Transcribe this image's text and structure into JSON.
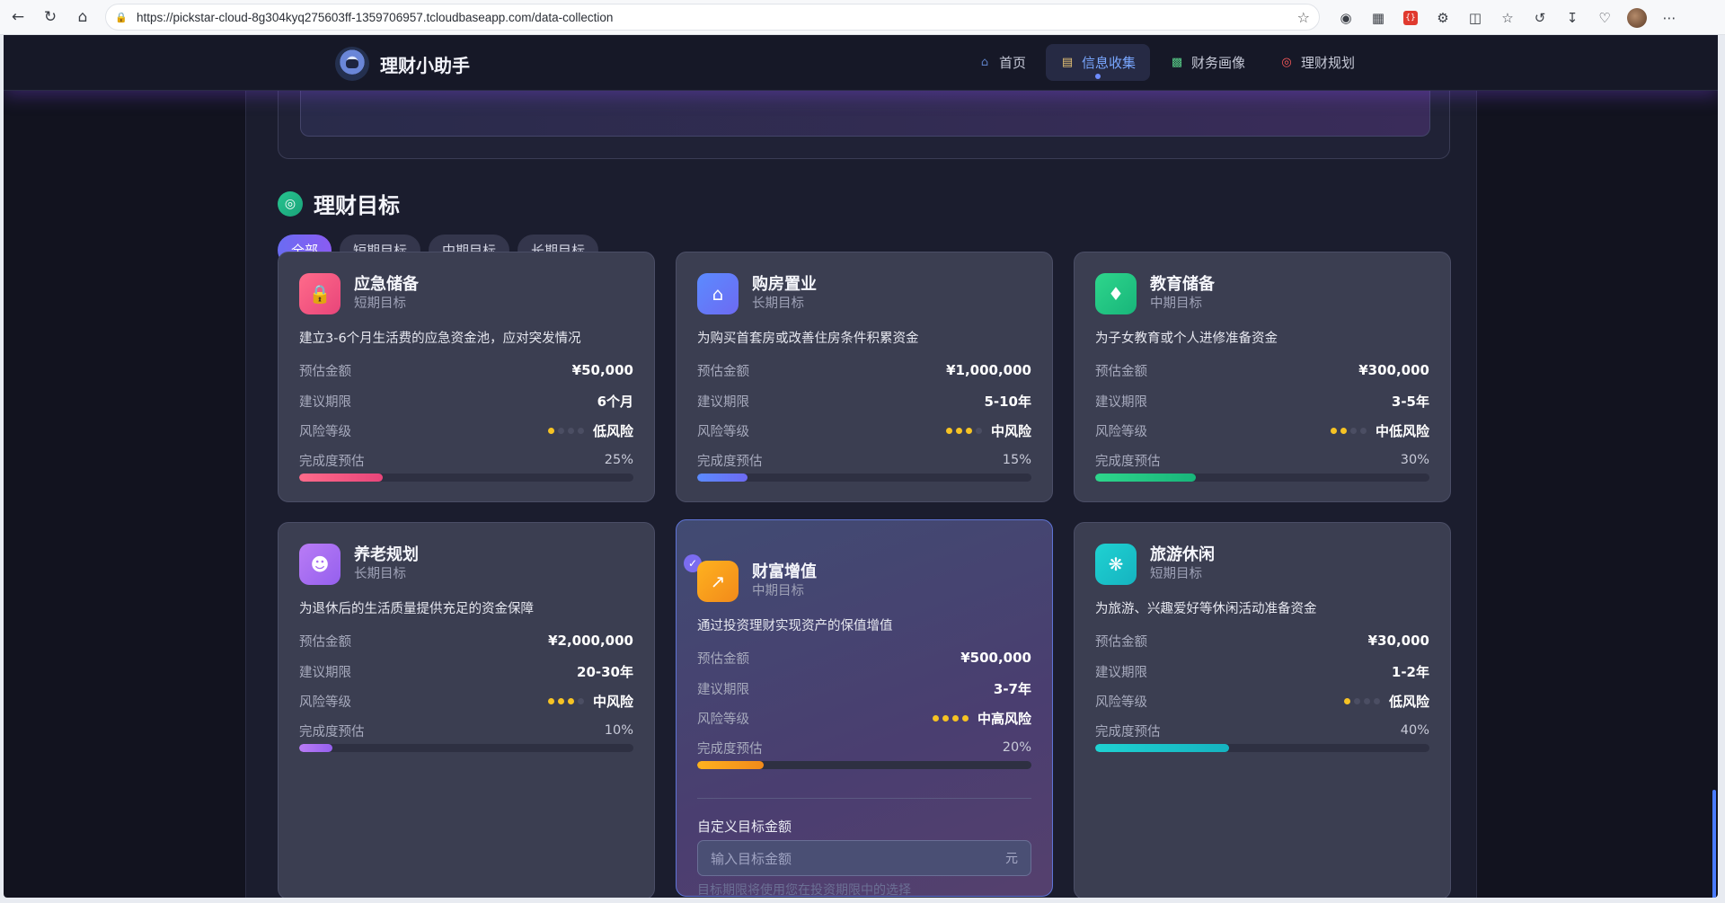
{
  "browser": {
    "url": "https://pickstar-cloud-8g304kyq275603ff-1359706957.tcloudbaseapp.com/data-collection"
  },
  "app": {
    "name": "理财小助手",
    "nav": [
      {
        "label": "首页",
        "icon": "home-icon",
        "active": false
      },
      {
        "label": "信息收集",
        "icon": "clipboard-icon",
        "active": true
      },
      {
        "label": "财务画像",
        "icon": "bar-chart-icon",
        "active": false
      },
      {
        "label": "理财规划",
        "icon": "target-icon",
        "active": false
      }
    ]
  },
  "section": {
    "title": "理财目标",
    "filters": [
      "全部",
      "短期目标",
      "中期目标",
      "长期目标"
    ],
    "active_filter": "全部"
  },
  "labels": {
    "amount": "预估金额",
    "period": "建议期限",
    "risk": "风险等级",
    "progress": "完成度预估"
  },
  "goals": [
    {
      "name": "应急储备",
      "term": "短期目标",
      "desc": "建立3-6个月生活费的应急资金池，应对突发情况",
      "amount": "¥50,000",
      "period": "6个月",
      "risk_label": "低风险",
      "risk_level": 1,
      "progress_text": "25%",
      "progress": 0.25,
      "icon": "lock-icon",
      "color_from": "#ff6b8a",
      "color_to": "#e8457a",
      "selected": false
    },
    {
      "name": "购房置业",
      "term": "长期目标",
      "desc": "为购买首套房或改善住房条件积累资金",
      "amount": "¥1,000,000",
      "period": "5-10年",
      "risk_label": "中风险",
      "risk_level": 3,
      "progress_text": "15%",
      "progress": 0.15,
      "icon": "house-icon",
      "color_from": "#5b8bff",
      "color_to": "#6d6af2",
      "selected": false
    },
    {
      "name": "教育储备",
      "term": "中期目标",
      "desc": "为子女教育或个人进修准备资金",
      "amount": "¥300,000",
      "period": "3-5年",
      "risk_label": "中低风险",
      "risk_level": 2,
      "progress_text": "30%",
      "progress": 0.3,
      "icon": "graduation-cap-icon",
      "color_from": "#2ed68c",
      "color_to": "#18b57a",
      "selected": false
    },
    {
      "name": "养老规划",
      "term": "长期目标",
      "desc": "为退休后的生活质量提供充足的资金保障",
      "amount": "¥2,000,000",
      "period": "20-30年",
      "risk_label": "中风险",
      "risk_level": 3,
      "progress_text": "10%",
      "progress": 0.1,
      "icon": "person-icon",
      "color_from": "#b97cf5",
      "color_to": "#9560ee",
      "selected": false
    },
    {
      "name": "财富增值",
      "term": "中期目标",
      "desc": "通过投资理财实现资产的保值增值",
      "amount": "¥500,000",
      "period": "3-7年",
      "risk_label": "中高风险",
      "risk_level": 4,
      "progress_text": "20%",
      "progress": 0.2,
      "icon": "trending-up-icon",
      "color_from": "#ffb21f",
      "color_to": "#f28a1a",
      "selected": true
    },
    {
      "name": "旅游休闲",
      "term": "短期目标",
      "desc": "为旅游、兴趣爱好等休闲活动准备资金",
      "amount": "¥30,000",
      "period": "1-2年",
      "risk_label": "低风险",
      "risk_level": 1,
      "progress_text": "40%",
      "progress": 0.4,
      "icon": "palm-tree-icon",
      "color_from": "#1fd2d2",
      "color_to": "#15b3c0",
      "selected": false
    }
  ],
  "custom": {
    "label": "自定义目标金额",
    "placeholder": "输入目标金额",
    "unit": "元",
    "hint": "目标期限将使用您在投资期限中的选择"
  }
}
